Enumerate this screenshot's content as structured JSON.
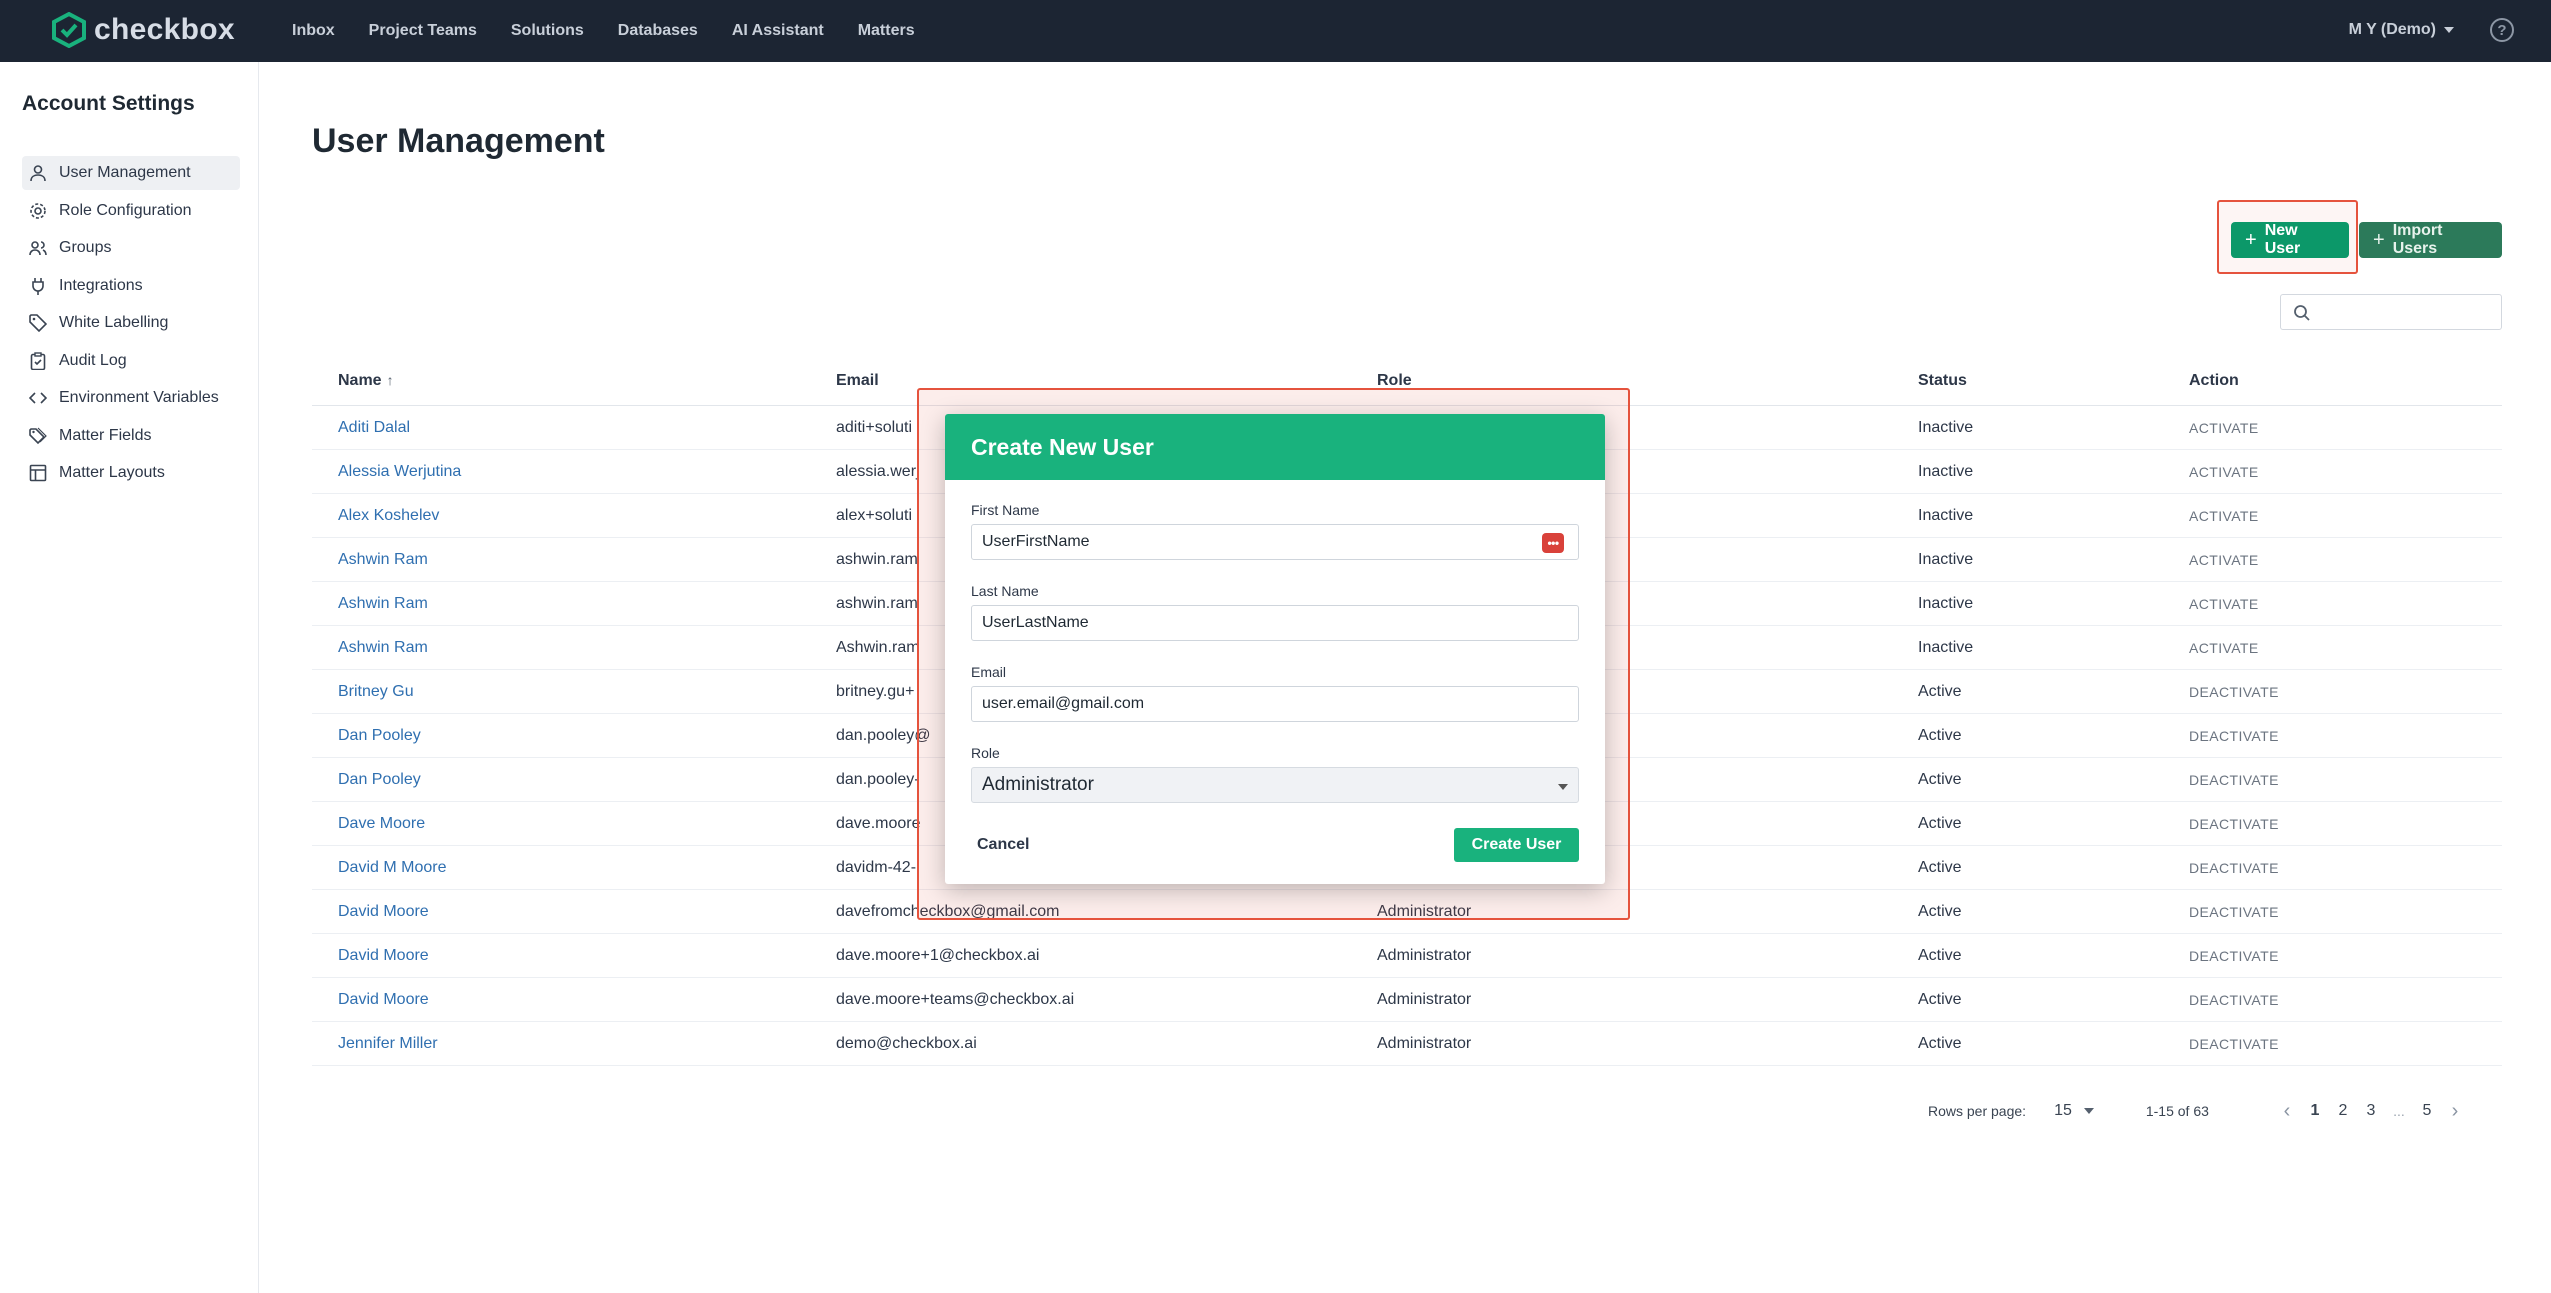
{
  "app": {
    "brand": "checkbox",
    "brand_color": "#19b27d"
  },
  "topnav": {
    "items": [
      "Inbox",
      "Project Teams",
      "Solutions",
      "Databases",
      "AI Assistant",
      "Matters"
    ],
    "account": "M Y (Demo)"
  },
  "sidebar": {
    "title": "Account Settings",
    "items": [
      {
        "label": "User Management",
        "icon": "user-icon"
      },
      {
        "label": "Role Configuration",
        "icon": "gear-icon"
      },
      {
        "label": "Groups",
        "icon": "users-icon"
      },
      {
        "label": "Integrations",
        "icon": "plug-icon"
      },
      {
        "label": "White Labelling",
        "icon": "tag-icon"
      },
      {
        "label": "Audit Log",
        "icon": "clipboard-icon"
      },
      {
        "label": "Environment Variables",
        "icon": "code-icon"
      },
      {
        "label": "Matter Fields",
        "icon": "tags-icon"
      },
      {
        "label": "Matter Layouts",
        "icon": "layout-icon"
      }
    ]
  },
  "main": {
    "title": "User Management",
    "new_user_label": "New User",
    "import_users_label": "Import Users",
    "search_placeholder": ""
  },
  "table": {
    "headers": {
      "name": "Name",
      "email": "Email",
      "role": "Role",
      "status": "Status",
      "action": "Action"
    },
    "rows": [
      {
        "name": "Aditi Dalal",
        "email": "aditi+soluti",
        "role": "",
        "status": "Inactive",
        "action": "ACTIVATE"
      },
      {
        "name": "Alessia Werjutina",
        "email": "alessia.werj",
        "role": "",
        "status": "Inactive",
        "action": "ACTIVATE"
      },
      {
        "name": "Alex Koshelev",
        "email": "alex+soluti",
        "role": "",
        "status": "Inactive",
        "action": "ACTIVATE"
      },
      {
        "name": "Ashwin Ram",
        "email": "ashwin.ram",
        "role": "",
        "status": "Inactive",
        "action": "ACTIVATE"
      },
      {
        "name": "Ashwin Ram",
        "email": "ashwin.ram",
        "role": "",
        "status": "Inactive",
        "action": "ACTIVATE"
      },
      {
        "name": "Ashwin Ram",
        "email": "Ashwin.ram",
        "role": "",
        "status": "Inactive",
        "action": "ACTIVATE"
      },
      {
        "name": "Britney Gu",
        "email": "britney.gu+",
        "role": "",
        "status": "Active",
        "action": "DEACTIVATE"
      },
      {
        "name": "Dan Pooley",
        "email": "dan.pooley@",
        "role": "",
        "status": "Active",
        "action": "DEACTIVATE"
      },
      {
        "name": "Dan Pooley",
        "email": "dan.pooley-",
        "role": "",
        "status": "Active",
        "action": "DEACTIVATE"
      },
      {
        "name": "Dave Moore",
        "email": "dave.moore",
        "role": "",
        "status": "Active",
        "action": "DEACTIVATE"
      },
      {
        "name": "David M Moore",
        "email": "davidm-42-",
        "role": "",
        "status": "Active",
        "action": "DEACTIVATE"
      },
      {
        "name": "David Moore",
        "email": "davefromcheckbox@gmail.com",
        "role": "Administrator",
        "status": "Active",
        "action": "DEACTIVATE"
      },
      {
        "name": "David Moore",
        "email": "dave.moore+1@checkbox.ai",
        "role": "Administrator",
        "status": "Active",
        "action": "DEACTIVATE"
      },
      {
        "name": "David Moore",
        "email": "dave.moore+teams@checkbox.ai",
        "role": "Administrator",
        "status": "Active",
        "action": "DEACTIVATE"
      },
      {
        "name": "Jennifer Miller",
        "email": "demo@checkbox.ai",
        "role": "Administrator",
        "status": "Active",
        "action": "DEACTIVATE"
      }
    ]
  },
  "pagination": {
    "rows_per_page_label": "Rows per page:",
    "rows_per_page": "15",
    "range": "1-15 of 63",
    "pages": [
      "1",
      "2",
      "3",
      "5"
    ],
    "current_page": "1",
    "ellipsis": "..."
  },
  "modal": {
    "title": "Create New User",
    "first_name_label": "First Name",
    "first_name_value": "UserFirstName",
    "last_name_label": "Last Name",
    "last_name_value": "UserLastName",
    "email_label": "Email",
    "email_value": "user.email@gmail.com",
    "role_label": "Role",
    "role_value": "Administrator",
    "cancel_label": "Cancel",
    "create_label": "Create User",
    "password_manager_glyph": "•••"
  }
}
